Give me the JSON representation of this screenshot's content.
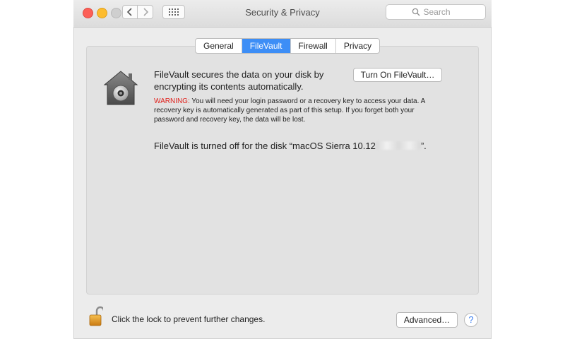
{
  "window": {
    "title": "Security & Privacy",
    "search_placeholder": "Search"
  },
  "tabs": [
    {
      "label": "General",
      "active": false
    },
    {
      "label": "FileVault",
      "active": true
    },
    {
      "label": "Firewall",
      "active": false
    },
    {
      "label": "Privacy",
      "active": false
    }
  ],
  "filevault": {
    "description": "FileVault secures the data on your disk by encrypting its contents automatically.",
    "turn_on_label": "Turn On FileVault…",
    "warning_label": "WARNING:",
    "warning_text": " You will need your login password or a recovery key to access your data. A recovery key is automatically generated as part of this setup. If you forget both your password and recovery key, the data will be lost.",
    "status_prefix": "FileVault is turned off for the disk “macOS Sierra 10.12",
    "status_suffix": "”."
  },
  "footer": {
    "lock_text": "Click the lock to prevent further changes.",
    "advanced_label": "Advanced…",
    "help_label": "?"
  },
  "icons": {
    "lock": "padlock-open-icon",
    "filevault": "filevault-house-icon",
    "search": "magnifier-icon"
  },
  "colors": {
    "accent": "#3d8ef6",
    "warning": "#e0201b",
    "close": "#fc5f57",
    "minimize": "#fdbc2e"
  }
}
